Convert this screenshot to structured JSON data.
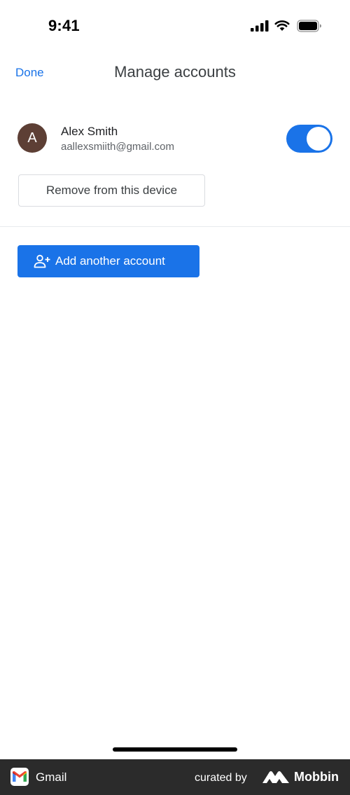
{
  "status_bar": {
    "time": "9:41",
    "icons": [
      "signal-icon",
      "wifi-icon",
      "battery-icon"
    ]
  },
  "header": {
    "done_label": "Done",
    "title": "Manage accounts"
  },
  "account": {
    "avatar_letter": "A",
    "avatar_color": "#5d3f35",
    "name": "Alex Smith",
    "email": "aallexsmiith@gmail.com",
    "toggle_on": true
  },
  "actions": {
    "remove_label": "Remove from this device",
    "add_label": "Add another account",
    "add_icon": "add-person-icon"
  },
  "brand_bar": {
    "app_name": "Gmail",
    "curated_by": "curated by",
    "brand_name": "Mobbin"
  },
  "colors": {
    "accent": "#1a73e8",
    "title_text": "#3c4043",
    "brand_bar_bg": "#2b2b2b"
  }
}
